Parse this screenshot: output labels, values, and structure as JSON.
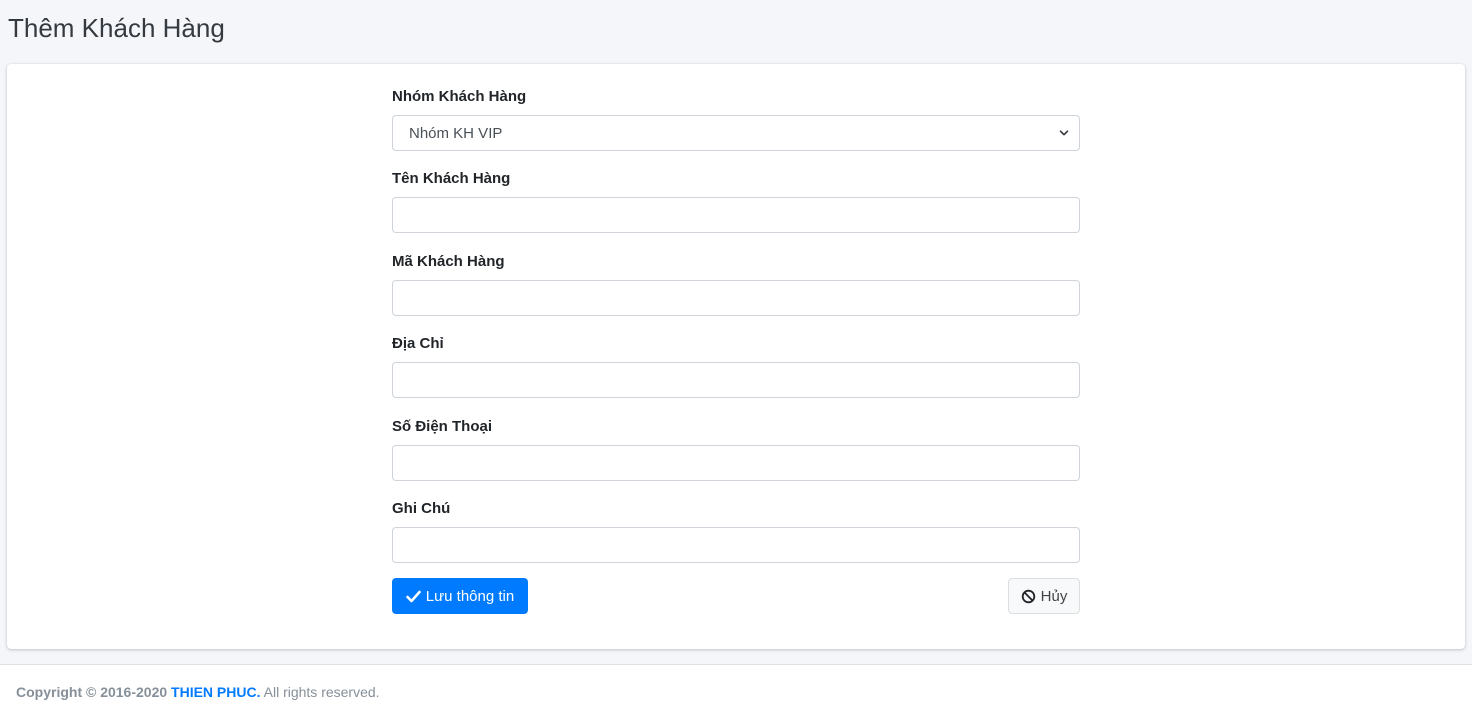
{
  "page": {
    "title": "Thêm Khách Hàng"
  },
  "form": {
    "group_label": "Nhóm Khách Hàng",
    "group_selected": "Nhóm KH VIP",
    "name_label": "Tên Khách Hàng",
    "name_value": "",
    "code_label": "Mã Khách Hàng",
    "code_value": "",
    "address_label": "Địa Chỉ",
    "address_value": "",
    "phone_label": "Số Điện Thoại",
    "phone_value": "",
    "note_label": "Ghi Chú",
    "note_value": ""
  },
  "actions": {
    "save_label": "Lưu thông tin",
    "save_icon": "check-icon",
    "cancel_label": "Hủy",
    "cancel_icon": "ban-icon"
  },
  "footer": {
    "copyright": "Copyright © 2016-2020",
    "brand": "THIEN PHUC.",
    "rights": "All rights reserved."
  },
  "colors": {
    "primary": "#007bff",
    "background": "#f4f6f9",
    "footer_text": "#869099"
  }
}
